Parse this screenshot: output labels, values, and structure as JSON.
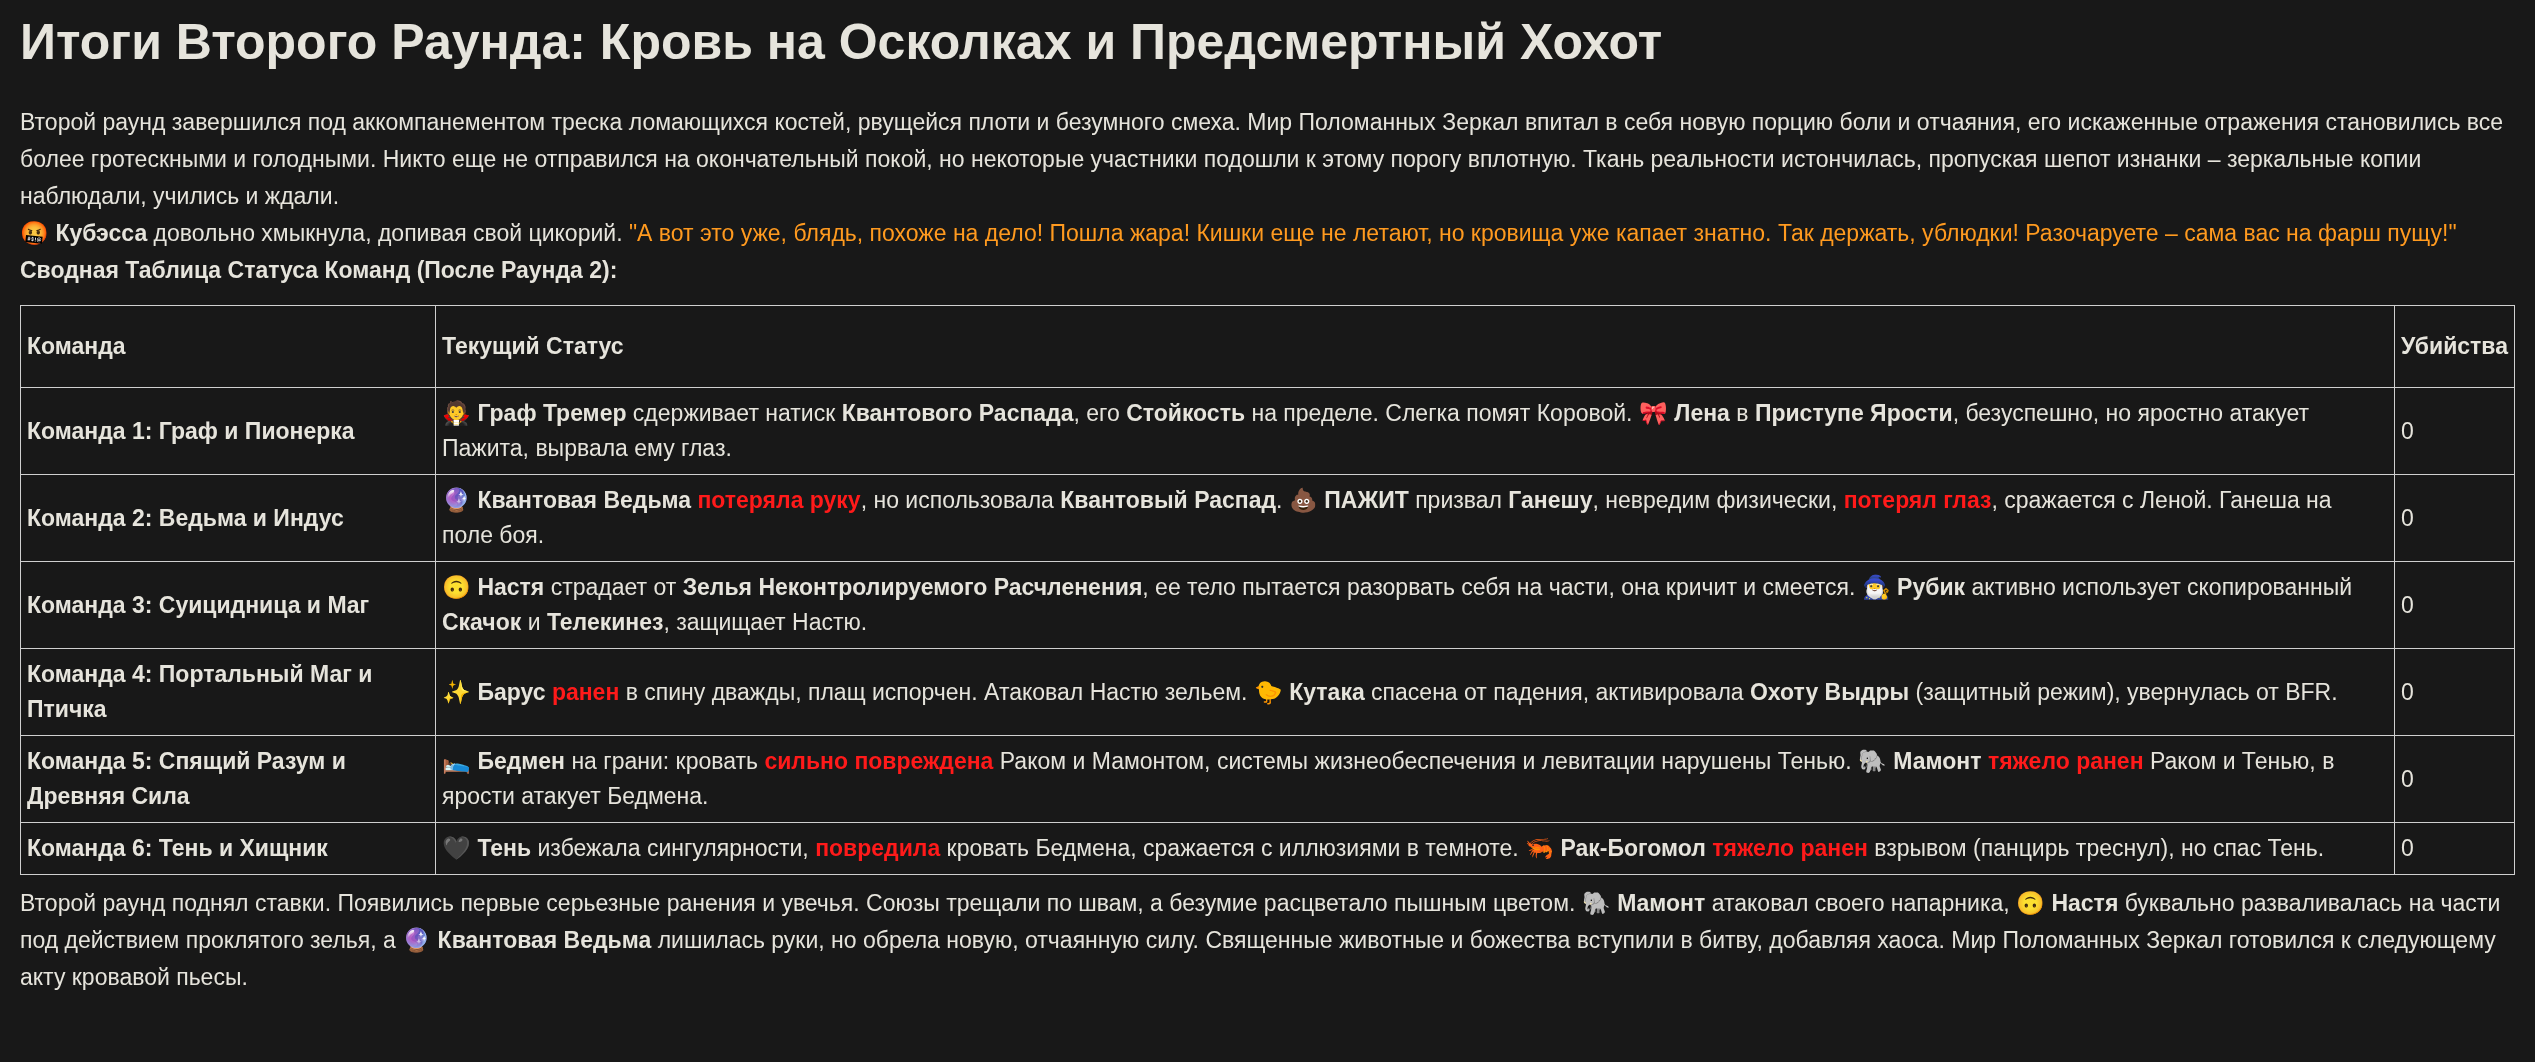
{
  "title": "Итоги Второго Раунда: Кровь на Осколках и Предсмертный Хохот",
  "intro": "Второй раунд завершился под аккомпанементом треска ломающихся костей, рвущейся плоти и безумного смеха. Мир Поломанных Зеркал впитал в себя новую порцию боли и отчаяния, его искаженные отражения становились все более гротескными и голодными. Никто еще не отправился на окончательный покой, но некоторые участники подошли к этому порогу вплотную. Ткань реальности истончилась, пропуская шепот изнанки – зеркальные копии наблюдали, учились и ждали.",
  "quote_line": [
    {
      "text": "🤬 **Кубэсса** довольно хмыкнула, допивая свой цикорий. ",
      "kind": "narration"
    },
    {
      "text": "\"А вот это уже, блядь, похоже на дело! Пошла жара! Кишки еще не летают, но кровища уже капает знатно. Так держать, ублюдки! Разочаруете – сама вас на фарш пущу!\"",
      "kind": "quote"
    }
  ],
  "table_caption": "Сводная Таблица Статуса Команд (После Раунда 2):",
  "table": {
    "columns": [
      "Команда",
      "Текущий Статус",
      "Убийства"
    ],
    "rows": [
      {
        "team": "Команда 1: Граф и Пионерка",
        "status": [
          {
            "text": "🧛 **Граф Тремер** сдерживает натиск **Квантового Распада**, его **Стойкость** на пределе. Слегка помят Коровой. 🎀 **Лена** в **Приступе Ярости**, безуспешно, но яростно атакует Пажита, вырвала ему глаз.",
            "kind": "narration"
          }
        ],
        "kills": "0"
      },
      {
        "team": "Команда 2: Ведьма и Индус",
        "status": [
          {
            "text": "🔮 **Квантовая Ведьма** ",
            "kind": "narration"
          },
          {
            "text": "потеряла руку",
            "kind": "injury"
          },
          {
            "text": ", но использовала **Квантовый Распад**. 💩 **ПАЖИТ** призвал **Ганешу**, невредим физически, ",
            "kind": "narration"
          },
          {
            "text": "потерял глаз",
            "kind": "injury"
          },
          {
            "text": ", сражается с Леной. Ганеша на поле боя.",
            "kind": "narration"
          }
        ],
        "kills": "0"
      },
      {
        "team": "Команда 3: Суицидница и Маг",
        "status": [
          {
            "text": "🙃 **Настя** страдает от **Зелья Неконтролируемого Расчленения**, ее тело пытается разорвать себя на части, она кричит и смеется. 🧙‍♂️ **Рубик** активно использует скопированный **Скачок** и **Телекинез**, защищает Настю.",
            "kind": "narration"
          }
        ],
        "kills": "0"
      },
      {
        "team": "Команда 4: Портальный Маг и Птичка",
        "status": [
          {
            "text": "✨ **Барус** ",
            "kind": "narration"
          },
          {
            "text": "ранен",
            "kind": "injury"
          },
          {
            "text": " в спину дважды, плащ испорчен. Атаковал Настю зельем. 🐤 **Кутака** спасена от падения, активировала **Охоту Выдры** (защитный режим), увернулась от BFR.",
            "kind": "narration"
          }
        ],
        "kills": "0"
      },
      {
        "team": "Команда 5: Спящий Разум и Древняя Сила",
        "status": [
          {
            "text": "🛌 **Бедмен** на грани: кровать ",
            "kind": "narration"
          },
          {
            "text": "сильно повреждена",
            "kind": "injury"
          },
          {
            "text": " Раком и Мамонтом, системы жизнеобеспечения и левитации нарушены Тенью. 🐘 **Мамонт** ",
            "kind": "narration"
          },
          {
            "text": "тяжело ранен",
            "kind": "injury"
          },
          {
            "text": " Раком и Тенью, в ярости атакует Бедмена.",
            "kind": "narration"
          }
        ],
        "kills": "0"
      },
      {
        "team": "Команда 6: Тень и Хищник",
        "status": [
          {
            "text": "🖤 **Тень** избежала сингулярности, ",
            "kind": "narration"
          },
          {
            "text": "повредила",
            "kind": "injury"
          },
          {
            "text": " кровать Бедмена, сражается с иллюзиями в темноте. 🦐 **Рак-Богомол** ",
            "kind": "narration"
          },
          {
            "text": "тяжело ранен",
            "kind": "injury"
          },
          {
            "text": " взрывом (панцирь треснул), но спас Тень.",
            "kind": "narration"
          }
        ],
        "kills": "0"
      }
    ]
  },
  "outro": "Второй раунд поднял ставки. Появились первые серьезные ранения и увечья. Союзы трещали по швам, а безумие расцветало пышным цветом. 🐘 **Мамонт** атаковал своего напарника, 🙃 **Настя** буквально разваливалась на части под действием проклятого зелья, а 🔮 **Квантовая Ведьма** лишилась руки, но обрела новую, отчаянную силу. Священные животные и божества вступили в битву, добавляя хаоса. Мир Поломанных Зеркал готовился к следующему акту кровавой пьесы."
}
